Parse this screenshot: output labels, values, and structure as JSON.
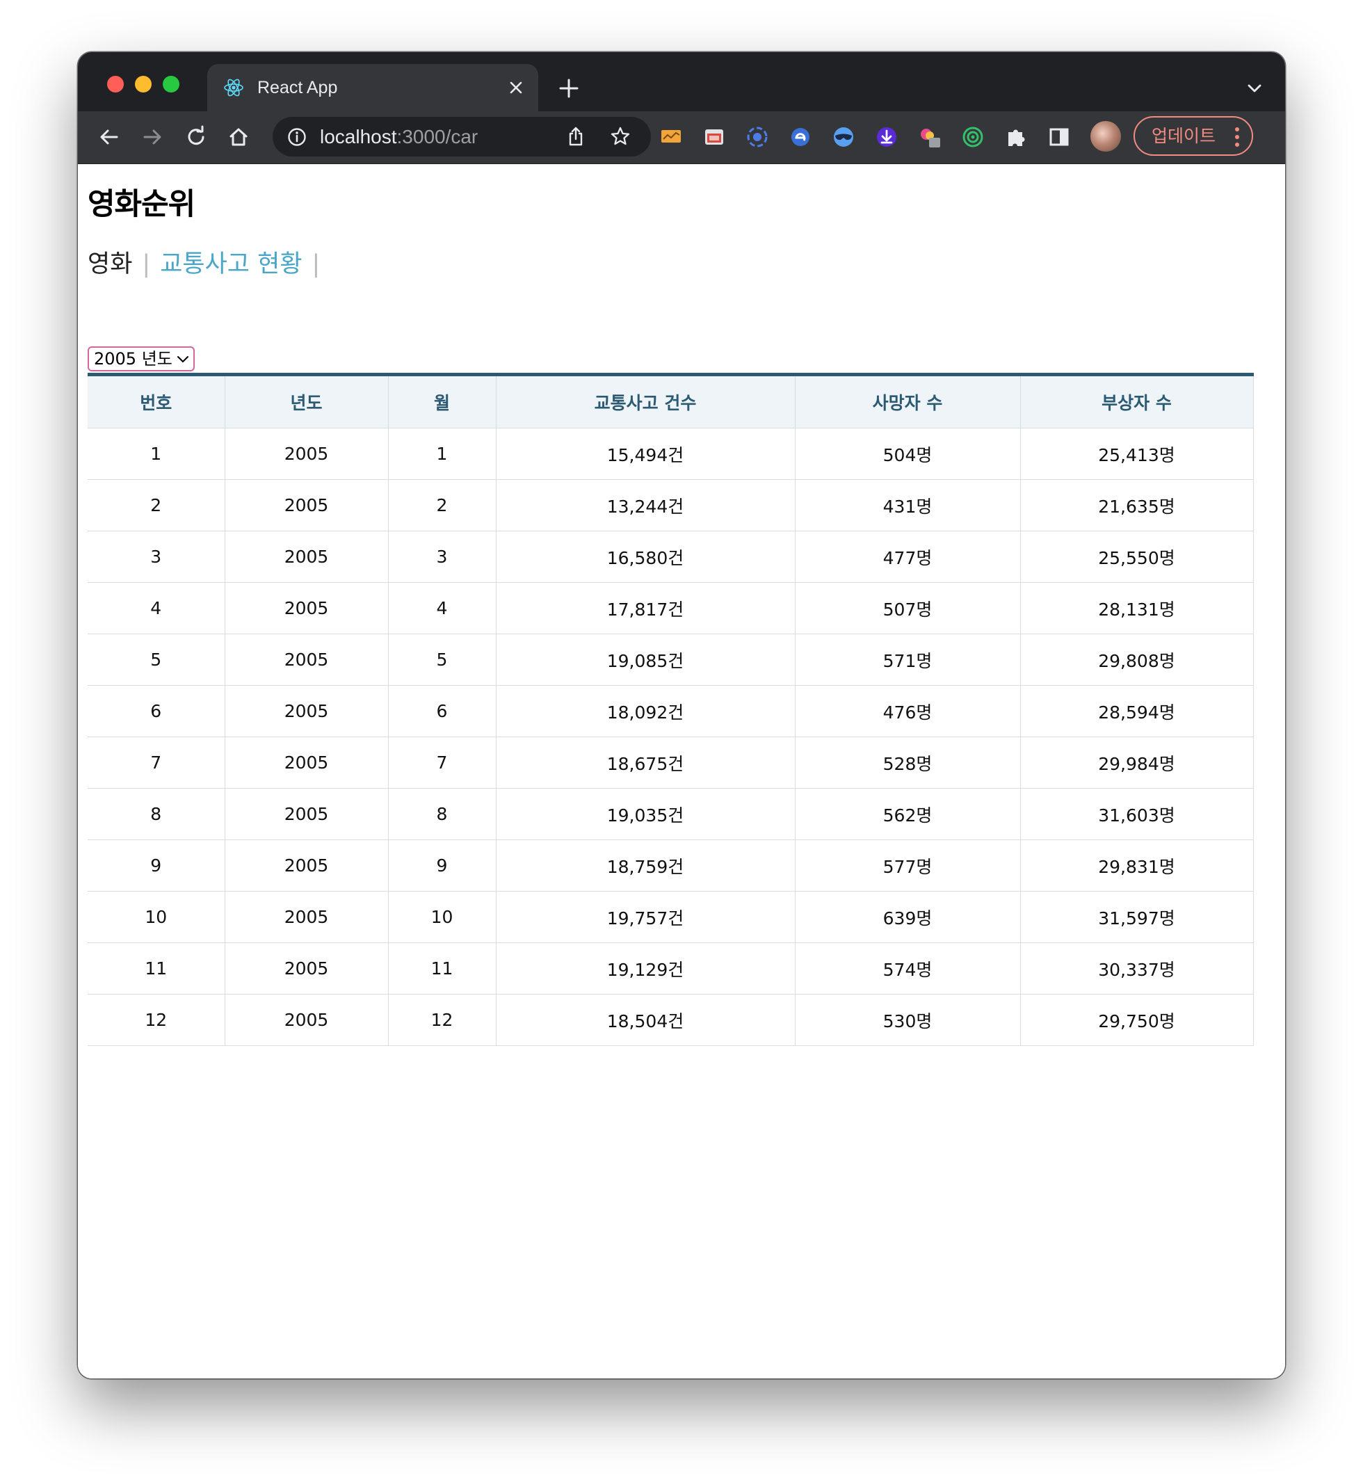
{
  "browser": {
    "tab_title": "React App",
    "url_host": "localhost",
    "url_path": ":3000/car",
    "update_label": "업데이트"
  },
  "page": {
    "title": "영화순위",
    "nav": [
      {
        "label": "영화"
      },
      {
        "label": "교통사고 현황"
      }
    ],
    "nav_separator": "|",
    "year_select": {
      "selected": "2005 년도"
    }
  },
  "table": {
    "headers": [
      "번호",
      "년도",
      "월",
      "교통사고 건수",
      "사망자 수",
      "부상자 수"
    ],
    "rows": [
      [
        "1",
        "2005",
        "1",
        "15,494건",
        "504명",
        "25,413명"
      ],
      [
        "2",
        "2005",
        "2",
        "13,244건",
        "431명",
        "21,635명"
      ],
      [
        "3",
        "2005",
        "3",
        "16,580건",
        "477명",
        "25,550명"
      ],
      [
        "4",
        "2005",
        "4",
        "17,817건",
        "507명",
        "28,131명"
      ],
      [
        "5",
        "2005",
        "5",
        "19,085건",
        "571명",
        "29,808명"
      ],
      [
        "6",
        "2005",
        "6",
        "18,092건",
        "476명",
        "28,594명"
      ],
      [
        "7",
        "2005",
        "7",
        "18,675건",
        "528명",
        "29,984명"
      ],
      [
        "8",
        "2005",
        "8",
        "19,035건",
        "562명",
        "31,603명"
      ],
      [
        "9",
        "2005",
        "9",
        "18,759건",
        "577명",
        "29,831명"
      ],
      [
        "10",
        "2005",
        "10",
        "19,757건",
        "639명",
        "31,597명"
      ],
      [
        "11",
        "2005",
        "11",
        "19,129건",
        "574명",
        "30,337명"
      ],
      [
        "12",
        "2005",
        "12",
        "18,504건",
        "530명",
        "29,750명"
      ]
    ]
  },
  "colors": {
    "header_text": "#2c5a73",
    "header_bg": "#eef4f7",
    "link": "#4aa6c8",
    "select_border": "#d6649e",
    "update_accent": "#f28b82"
  }
}
